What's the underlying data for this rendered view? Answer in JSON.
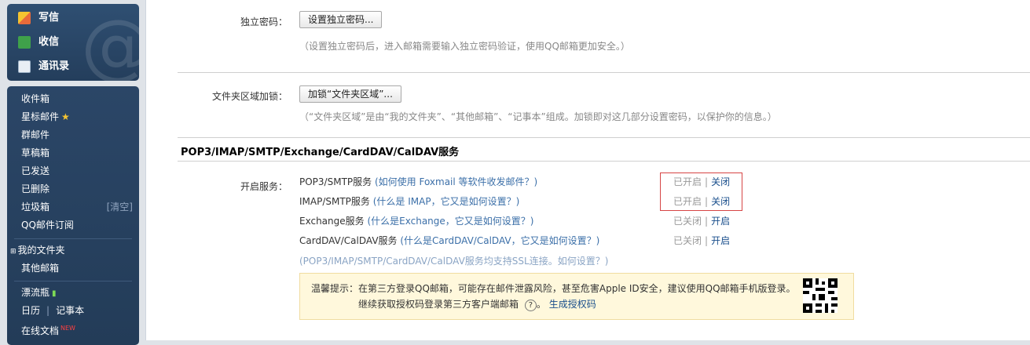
{
  "sidebar": {
    "actions": [
      {
        "label": "写信",
        "icon": "pencil-icon"
      },
      {
        "label": "收信",
        "icon": "download-icon"
      },
      {
        "label": "通讯录",
        "icon": "contacts-icon"
      }
    ],
    "folders": [
      {
        "label": "收件箱"
      },
      {
        "label": "星标邮件"
      },
      {
        "label": "群邮件"
      },
      {
        "label": "草稿箱"
      },
      {
        "label": "已发送"
      },
      {
        "label": "已删除"
      },
      {
        "label": "垃圾箱",
        "extra": "[清空]"
      },
      {
        "label": "QQ邮件订阅"
      }
    ],
    "my_folders": "我的文件夹",
    "other_mail": "其他邮箱",
    "bottle": "漂流瓶",
    "calendar": "日历",
    "calendar_sep": "|",
    "notebook": "记事本",
    "docs": "在线文档",
    "docs_badge": "NEW"
  },
  "main": {
    "independent_password": {
      "label": "独立密码：",
      "button": "设置独立密码...",
      "hint": "（设置独立密码后，进入邮箱需要输入独立密码验证，使用QQ邮箱更加安全。）"
    },
    "folder_lock": {
      "label": "文件夹区域加锁：",
      "button": "加锁“文件夹区域”...",
      "hint": "（“文件夹区域”是由“我的文件夹”、“其他邮箱”、“记事本”组成。加锁即对这几部分设置密码，以保护你的信息。）"
    },
    "section_title": "POP3/IMAP/SMTP/Exchange/CardDAV/CalDAV服务",
    "services_label": "开启服务：",
    "services": [
      {
        "name": "POP3/SMTP服务",
        "question": "(如何使用 Foxmail 等软件收发邮件？)",
        "state": "已开启",
        "action": "关闭"
      },
      {
        "name": "IMAP/SMTP服务",
        "question": "(什么是 IMAP，它又是如何设置？)",
        "state": "已开启",
        "action": "关闭"
      },
      {
        "name": "Exchange服务",
        "question": "(什么是Exchange，它又是如何设置？)",
        "state": "已关闭",
        "action": "开启"
      },
      {
        "name": "CardDAV/CalDAV服务",
        "question": "(什么是CardDAV/CalDAV，它又是如何设置？)",
        "state": "已关闭",
        "action": "开启"
      }
    ],
    "ssl_note": "(POP3/IMAP/SMTP/CardDAV/CalDAV服务均支持SSL连接。如何设置？)",
    "tip": {
      "line1": "温馨提示：在第三方登录QQ邮箱，可能存在邮件泄露风险，甚至危害Apple ID安全，建议使用QQ邮箱手机版登录。",
      "line2": "继续获取授权码登录第三方客户端邮箱",
      "help": "?",
      "link": "生成授权码",
      "period": "。"
    }
  },
  "colors": {
    "sidebar": "#243e5c",
    "accent": "#1a4f8c",
    "highlight": "#d64545",
    "tip_bg": "#fff8dc"
  }
}
